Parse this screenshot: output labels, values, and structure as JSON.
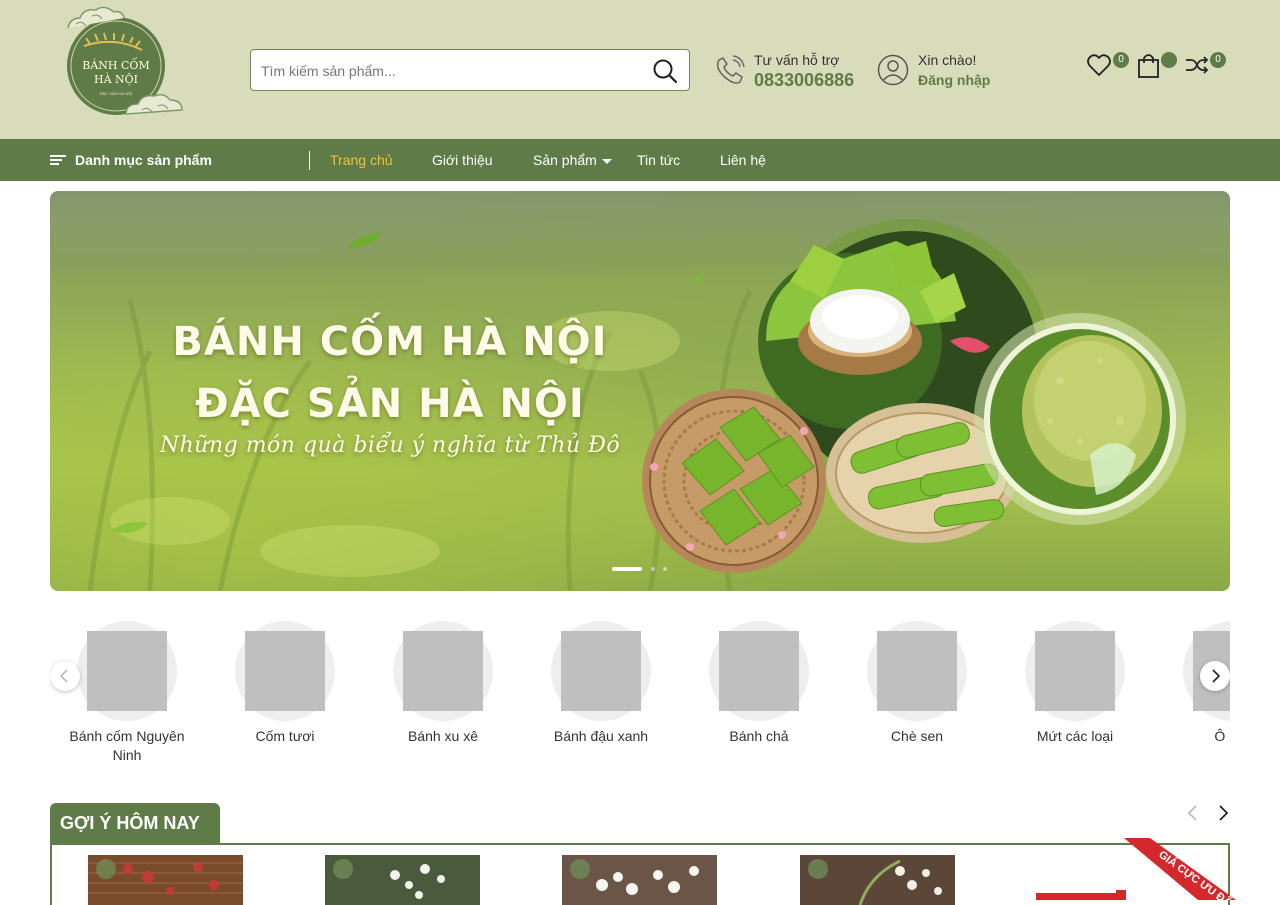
{
  "brand": {
    "logo_line1": "BÁNH CỐM",
    "logo_line2": "HÀ NỘI",
    "logo_tagline": "ĐẶC SẢN HÀ NỘI"
  },
  "search": {
    "placeholder": "Tìm kiếm sản phẩm...",
    "value": ""
  },
  "support": {
    "label": "Tư vấn hỗ trợ",
    "phone": "0833006886"
  },
  "account": {
    "greeting": "Xin chào!",
    "login": "Đăng nhập"
  },
  "header_counts": {
    "wishlist": "0",
    "cart": "",
    "compare": "0"
  },
  "colors": {
    "header_bg": "#d9dcbb",
    "primary_green": "#5f7c48",
    "nav_active": "#f1c232"
  },
  "nav": {
    "category_menu": "Danh mục sản phẩm",
    "links": [
      "Trang chủ",
      "Giới thiệu",
      "Sản phẩm",
      "Tin tức",
      "Liên hệ"
    ],
    "active": "Trang chủ"
  },
  "banner": {
    "line1": "BÁNH CỐM HÀ NỘI",
    "line2": "ĐẶC SẢN HÀ NỘI",
    "line3": "Những món quà biểu ý nghĩa từ Thủ Đô",
    "slides": 3,
    "active_slide": 1
  },
  "categories": [
    "Bánh cốm Nguyên Ninh",
    "Cốm tươi",
    "Bánh xu xê",
    "Bánh đậu xanh",
    "Bánh chả",
    "Chè sen",
    "Mứt các loại",
    "Ô mai"
  ],
  "suggested": {
    "title": "GỢI Ý HÔM NAY",
    "ribbon": "GIÁ CỰC ƯU ĐÃI"
  }
}
